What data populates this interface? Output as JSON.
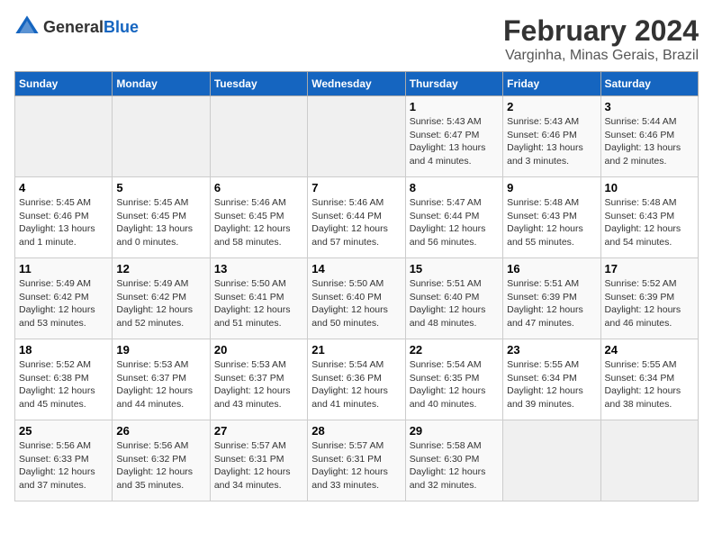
{
  "header": {
    "logo_general": "General",
    "logo_blue": "Blue",
    "month_year": "February 2024",
    "location": "Varginha, Minas Gerais, Brazil"
  },
  "days_of_week": [
    "Sunday",
    "Monday",
    "Tuesday",
    "Wednesday",
    "Thursday",
    "Friday",
    "Saturday"
  ],
  "weeks": [
    [
      {
        "day": "",
        "info": ""
      },
      {
        "day": "",
        "info": ""
      },
      {
        "day": "",
        "info": ""
      },
      {
        "day": "",
        "info": ""
      },
      {
        "day": "1",
        "info": "Sunrise: 5:43 AM\nSunset: 6:47 PM\nDaylight: 13 hours\nand 4 minutes."
      },
      {
        "day": "2",
        "info": "Sunrise: 5:43 AM\nSunset: 6:46 PM\nDaylight: 13 hours\nand 3 minutes."
      },
      {
        "day": "3",
        "info": "Sunrise: 5:44 AM\nSunset: 6:46 PM\nDaylight: 13 hours\nand 2 minutes."
      }
    ],
    [
      {
        "day": "4",
        "info": "Sunrise: 5:45 AM\nSunset: 6:46 PM\nDaylight: 13 hours\nand 1 minute."
      },
      {
        "day": "5",
        "info": "Sunrise: 5:45 AM\nSunset: 6:45 PM\nDaylight: 13 hours\nand 0 minutes."
      },
      {
        "day": "6",
        "info": "Sunrise: 5:46 AM\nSunset: 6:45 PM\nDaylight: 12 hours\nand 58 minutes."
      },
      {
        "day": "7",
        "info": "Sunrise: 5:46 AM\nSunset: 6:44 PM\nDaylight: 12 hours\nand 57 minutes."
      },
      {
        "day": "8",
        "info": "Sunrise: 5:47 AM\nSunset: 6:44 PM\nDaylight: 12 hours\nand 56 minutes."
      },
      {
        "day": "9",
        "info": "Sunrise: 5:48 AM\nSunset: 6:43 PM\nDaylight: 12 hours\nand 55 minutes."
      },
      {
        "day": "10",
        "info": "Sunrise: 5:48 AM\nSunset: 6:43 PM\nDaylight: 12 hours\nand 54 minutes."
      }
    ],
    [
      {
        "day": "11",
        "info": "Sunrise: 5:49 AM\nSunset: 6:42 PM\nDaylight: 12 hours\nand 53 minutes."
      },
      {
        "day": "12",
        "info": "Sunrise: 5:49 AM\nSunset: 6:42 PM\nDaylight: 12 hours\nand 52 minutes."
      },
      {
        "day": "13",
        "info": "Sunrise: 5:50 AM\nSunset: 6:41 PM\nDaylight: 12 hours\nand 51 minutes."
      },
      {
        "day": "14",
        "info": "Sunrise: 5:50 AM\nSunset: 6:40 PM\nDaylight: 12 hours\nand 50 minutes."
      },
      {
        "day": "15",
        "info": "Sunrise: 5:51 AM\nSunset: 6:40 PM\nDaylight: 12 hours\nand 48 minutes."
      },
      {
        "day": "16",
        "info": "Sunrise: 5:51 AM\nSunset: 6:39 PM\nDaylight: 12 hours\nand 47 minutes."
      },
      {
        "day": "17",
        "info": "Sunrise: 5:52 AM\nSunset: 6:39 PM\nDaylight: 12 hours\nand 46 minutes."
      }
    ],
    [
      {
        "day": "18",
        "info": "Sunrise: 5:52 AM\nSunset: 6:38 PM\nDaylight: 12 hours\nand 45 minutes."
      },
      {
        "day": "19",
        "info": "Sunrise: 5:53 AM\nSunset: 6:37 PM\nDaylight: 12 hours\nand 44 minutes."
      },
      {
        "day": "20",
        "info": "Sunrise: 5:53 AM\nSunset: 6:37 PM\nDaylight: 12 hours\nand 43 minutes."
      },
      {
        "day": "21",
        "info": "Sunrise: 5:54 AM\nSunset: 6:36 PM\nDaylight: 12 hours\nand 41 minutes."
      },
      {
        "day": "22",
        "info": "Sunrise: 5:54 AM\nSunset: 6:35 PM\nDaylight: 12 hours\nand 40 minutes."
      },
      {
        "day": "23",
        "info": "Sunrise: 5:55 AM\nSunset: 6:34 PM\nDaylight: 12 hours\nand 39 minutes."
      },
      {
        "day": "24",
        "info": "Sunrise: 5:55 AM\nSunset: 6:34 PM\nDaylight: 12 hours\nand 38 minutes."
      }
    ],
    [
      {
        "day": "25",
        "info": "Sunrise: 5:56 AM\nSunset: 6:33 PM\nDaylight: 12 hours\nand 37 minutes."
      },
      {
        "day": "26",
        "info": "Sunrise: 5:56 AM\nSunset: 6:32 PM\nDaylight: 12 hours\nand 35 minutes."
      },
      {
        "day": "27",
        "info": "Sunrise: 5:57 AM\nSunset: 6:31 PM\nDaylight: 12 hours\nand 34 minutes."
      },
      {
        "day": "28",
        "info": "Sunrise: 5:57 AM\nSunset: 6:31 PM\nDaylight: 12 hours\nand 33 minutes."
      },
      {
        "day": "29",
        "info": "Sunrise: 5:58 AM\nSunset: 6:30 PM\nDaylight: 12 hours\nand 32 minutes."
      },
      {
        "day": "",
        "info": ""
      },
      {
        "day": "",
        "info": ""
      }
    ]
  ]
}
